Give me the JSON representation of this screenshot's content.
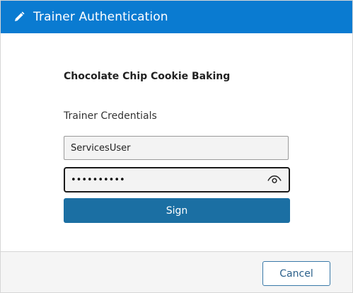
{
  "window": {
    "title": "Trainer Authentication",
    "title_icon": "pencil-icon"
  },
  "form": {
    "course_title": "Chocolate Chip Cookie Baking",
    "section_label": "Trainer Credentials",
    "username_value": "ServicesUser",
    "password_value": "••••••••••",
    "show_password_icon": "eye-icon",
    "sign_label": "Sign"
  },
  "footer": {
    "cancel_label": "Cancel"
  },
  "colors": {
    "titlebar": "#0a7bd1",
    "primary_button": "#1b6fa3",
    "footer_background": "#f5f5f5"
  }
}
